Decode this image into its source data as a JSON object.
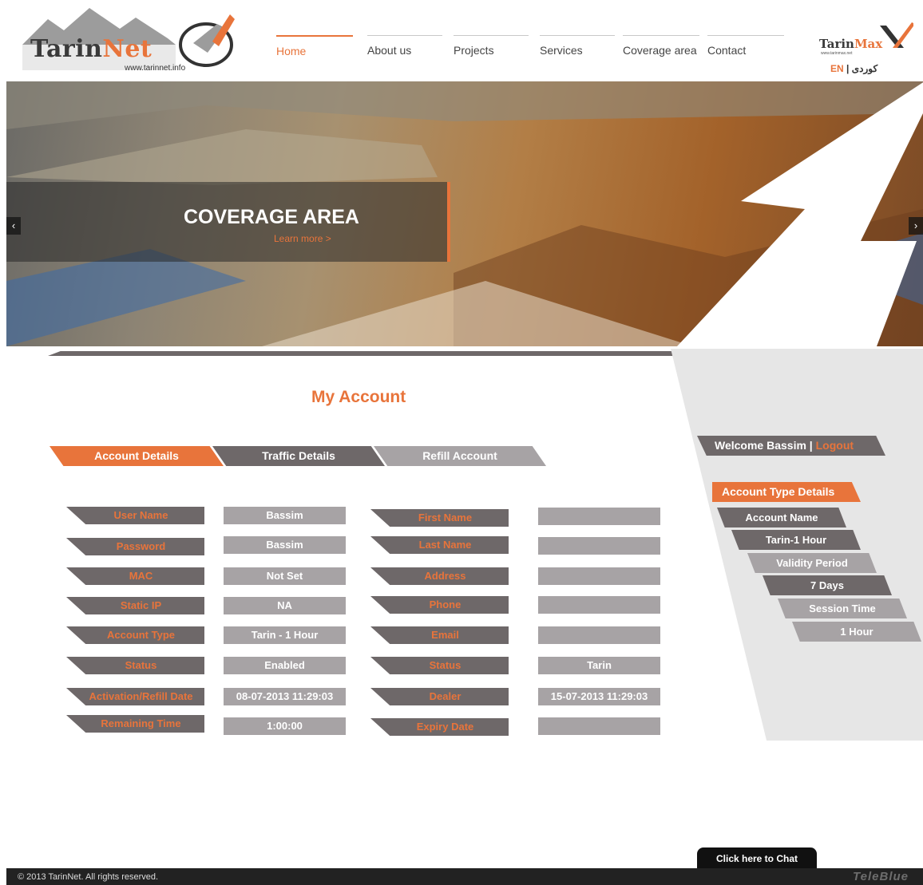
{
  "header": {
    "logo_part1": "Tarin",
    "logo_part2": "Net",
    "logo_url": "www.tarinnet.info",
    "nav": [
      {
        "label": "Home",
        "active": true
      },
      {
        "label": "About us"
      },
      {
        "label": "Projects"
      },
      {
        "label": "Services"
      },
      {
        "label": "Coverage area"
      },
      {
        "label": "Contact"
      }
    ],
    "max_logo_part1": "Tarin",
    "max_logo_part2": "Max",
    "max_logo_url": "www.tarinmax.net",
    "lang_en": "EN",
    "lang_sep": "|",
    "lang_ku": "کوردی"
  },
  "slider": {
    "heading": "COVERAGE AREA",
    "link": "Learn more >",
    "prev_glyph": "‹",
    "next_glyph": "›"
  },
  "main": {
    "title": "My Account",
    "tabs": [
      "Account Details",
      "Traffic Details",
      "Refill Account"
    ],
    "left_fields": [
      {
        "label": "User Name",
        "value": "Bassim"
      },
      {
        "label": "Password",
        "value": "Bassim"
      },
      {
        "label": "MAC",
        "value": "Not Set"
      },
      {
        "label": "Static IP",
        "value": "NA"
      },
      {
        "label": "Account Type",
        "value": "Tarin - 1 Hour"
      },
      {
        "label": "Status",
        "value": "Enabled"
      },
      {
        "label": "Activation/Refill Date",
        "value": "08-07-2013 11:29:03"
      },
      {
        "label": "Remaining Time",
        "value": "1:00:00"
      }
    ],
    "right_fields": [
      {
        "label": "First Name",
        "value": ""
      },
      {
        "label": "Last Name",
        "value": ""
      },
      {
        "label": "Address",
        "value": ""
      },
      {
        "label": "Phone",
        "value": ""
      },
      {
        "label": "Email",
        "value": ""
      },
      {
        "label": "Status",
        "value": "Tarin"
      },
      {
        "label": "Dealer",
        "value": "15-07-2013 11:29:03"
      },
      {
        "label": "Expiry Date",
        "value": ""
      }
    ]
  },
  "side": {
    "welcome": "Welcome Bassim",
    "separator": "|",
    "logout": "Logout",
    "account_type_title": "Account Type Details",
    "items": [
      {
        "text": "Account Name",
        "tone": "dk"
      },
      {
        "text": "Tarin-1 Hour",
        "tone": "dk"
      },
      {
        "text": "Validity Period",
        "tone": "lt"
      },
      {
        "text": "7 Days",
        "tone": "dk"
      },
      {
        "text": "Session Time",
        "tone": "lt"
      },
      {
        "text": "1 Hour",
        "tone": "lt"
      }
    ]
  },
  "footer": {
    "chat": "Click here to Chat",
    "copyright": "© 2013 TarinNet. All rights reserved.",
    "brand": "TeleBlue"
  },
  "colors": {
    "accent": "#e8743b",
    "dark": "#6e6869",
    "light": "#a7a3a5",
    "panel": "#e6e6e6"
  }
}
